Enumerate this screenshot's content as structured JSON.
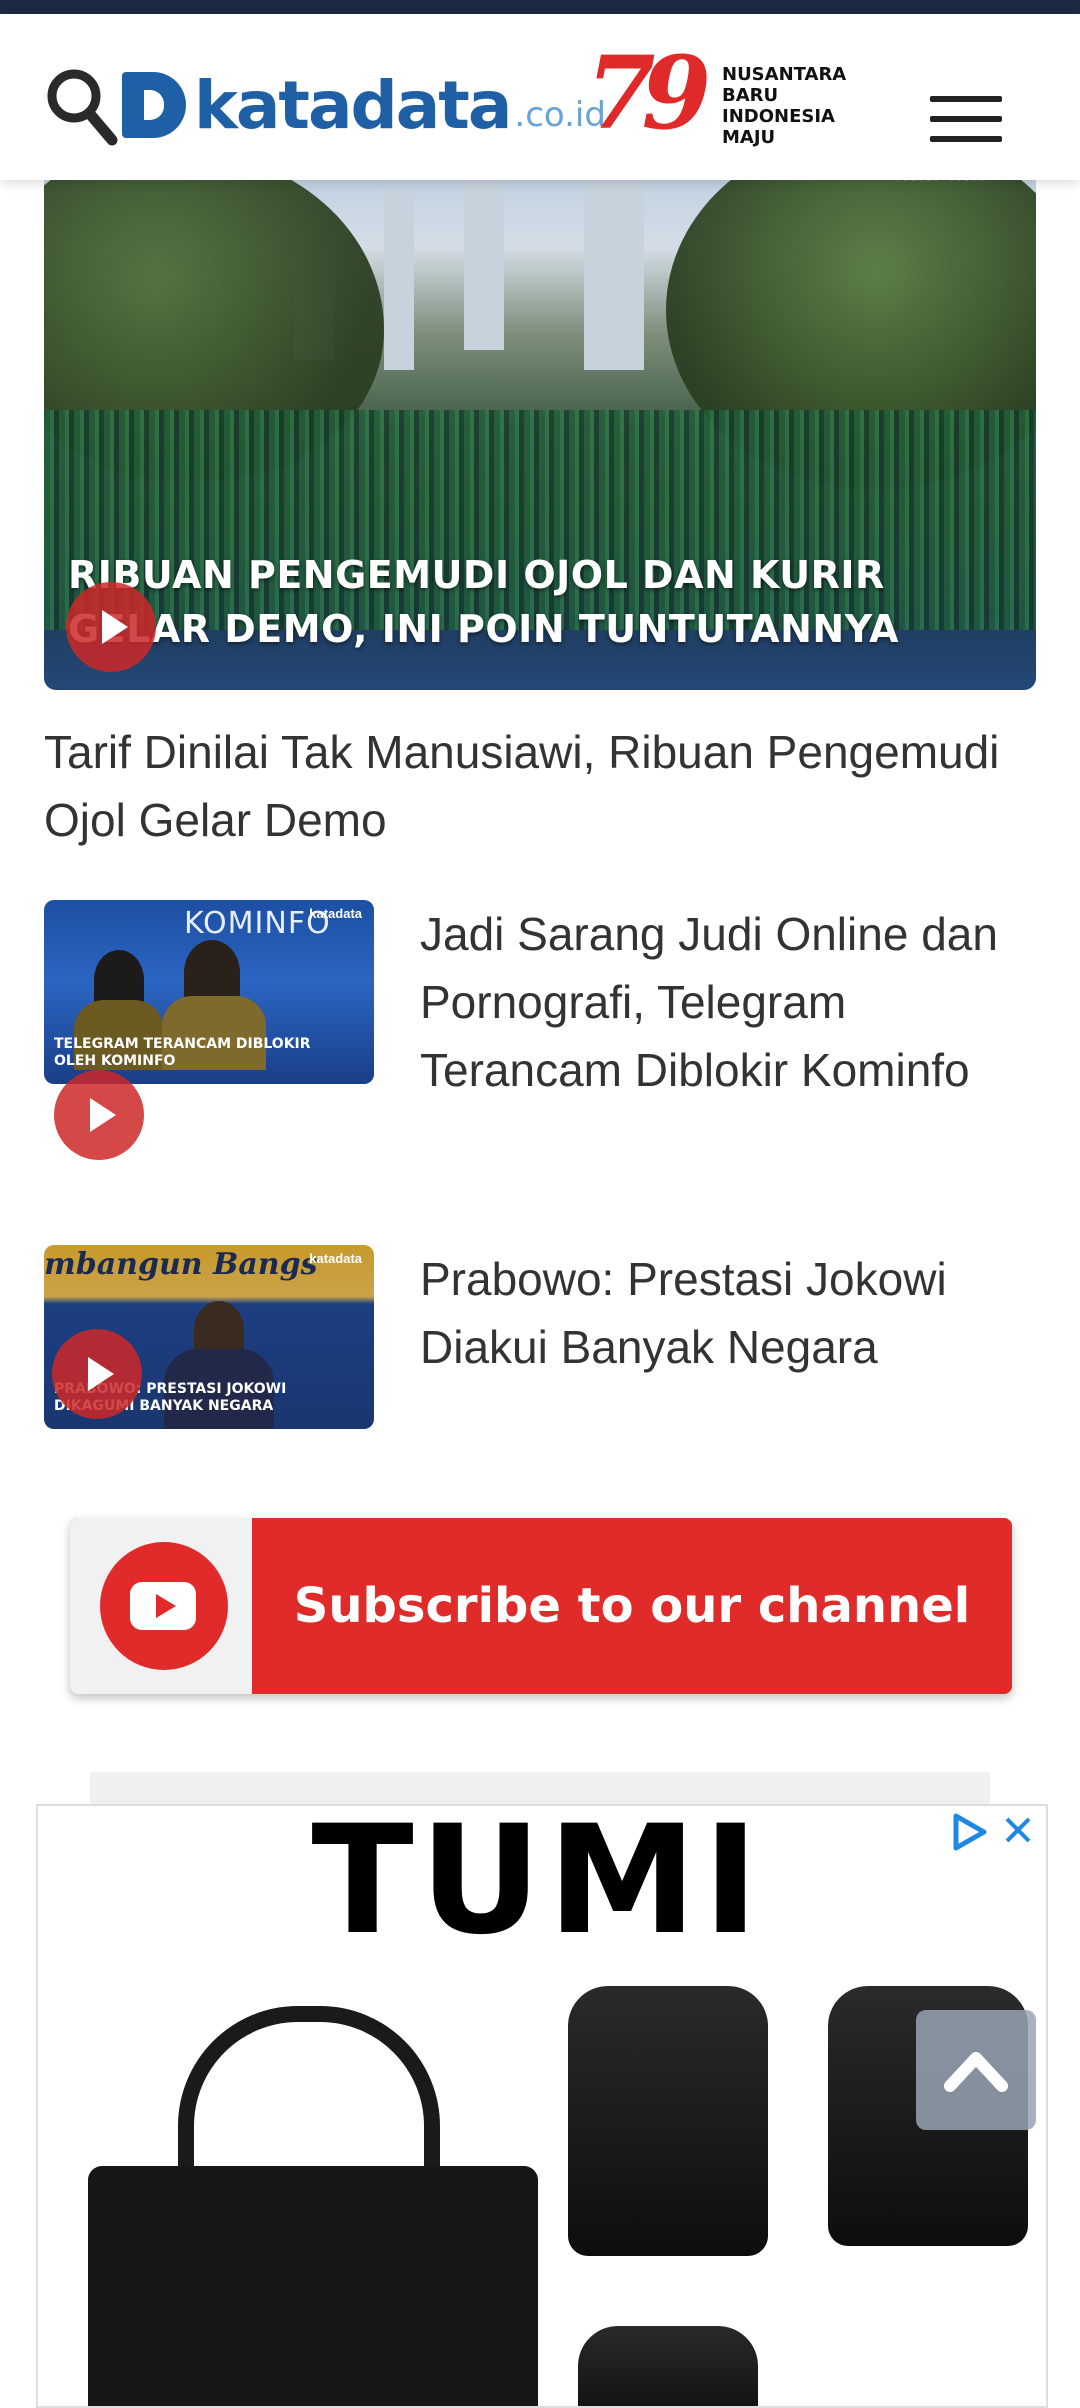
{
  "header": {
    "logo_text": "katadata",
    "logo_tld": ".co.id",
    "anniversary_number": "79",
    "anniversary_lines": [
      "NUSANTARA",
      "BARU",
      "INDONESIA",
      "MAJU"
    ]
  },
  "hero": {
    "image_caption_line1": "RIBUAN PENGEMUDI OJOL DAN KURIR",
    "image_caption_line2": "GELAR DEMO, INI POIN TUNTUTANNYA",
    "watermark": "katadata",
    "title": "Tarif Dinilai Tak Manusiawi, Ribuan Pengemudi Ojol Gelar Demo"
  },
  "videos": [
    {
      "thumb_caption_line1": "TELEGRAM TERANCAM DIBLOKIR",
      "thumb_caption_line2": "OLEH KOMINFO",
      "thumb_banner": "KOMINFO",
      "thumb_watermark": "katadata",
      "title": "Jadi Sarang Judi Online dan Pornografi, Telegram Terancam Diblokir Kominfo"
    },
    {
      "thumb_caption_line1": "PRABOWO: PRESTASI JOKOWI",
      "thumb_caption_line2": "DIKAGUMI BANYAK NEGARA",
      "thumb_banner": "mbangun Bangs",
      "thumb_watermark": "katadata",
      "title": "Prabowo: Prestasi Jokowi Diakui Banyak Negara"
    }
  ],
  "subscribe": {
    "label": "Subscribe to our channel"
  },
  "ad": {
    "brand": "TUMI"
  },
  "colors": {
    "brand_blue": "#1e5fa6",
    "accent_red": "#e12a2a",
    "topbar": "#1c2a42"
  },
  "icons": [
    "search-icon",
    "hamburger-menu-icon",
    "play-icon",
    "youtube-icon",
    "adchoices-icon",
    "close-icon",
    "chevron-up-icon"
  ]
}
